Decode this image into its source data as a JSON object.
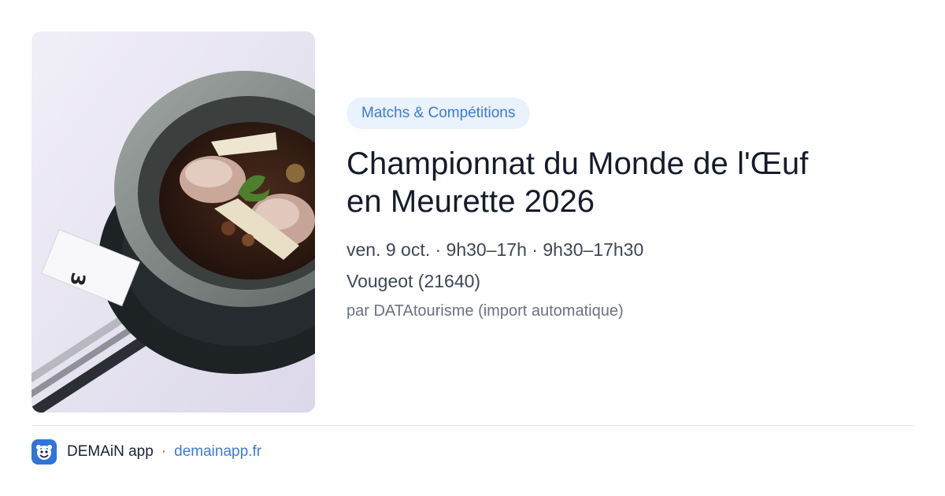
{
  "event": {
    "category": "Matchs & Compétitions",
    "title_line1": "Championnat du Monde de l'Œuf",
    "title_line2": "en Meurette 2026",
    "date": "ven. 9 oct. · 9h30–17h · 9h30–17h30",
    "location": "Vougeot (21640)",
    "source": "par DATAtourisme (import automatique)",
    "image": {
      "table_card_number": "3"
    }
  },
  "footer": {
    "app_name": "DEMAiN app",
    "separator": "·",
    "link": "demainapp.fr",
    "logo_icon": "demain-logo-icon"
  },
  "colors": {
    "accent": "#3d7bd1",
    "category_bg": "#eaf2fd",
    "title": "#141c2b",
    "logo_bg": "#2f74d8"
  }
}
